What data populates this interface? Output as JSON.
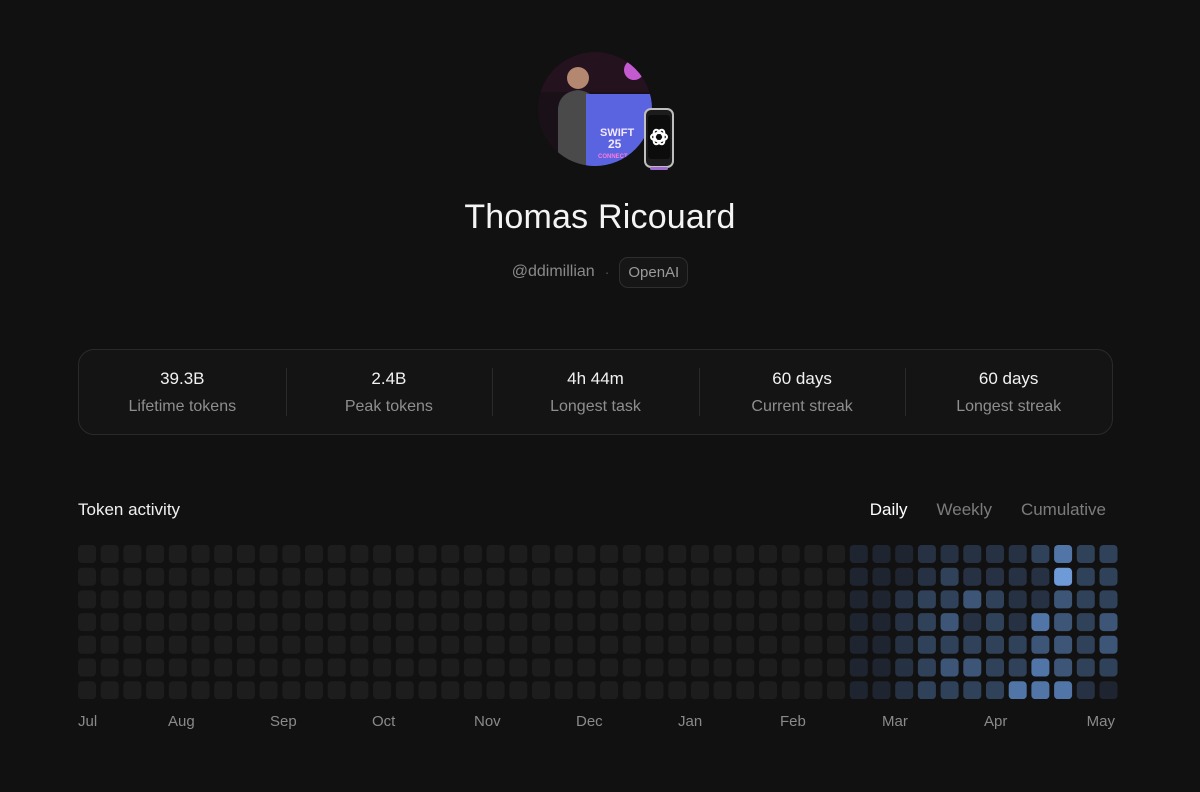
{
  "profile": {
    "name": "Thomas Ricouard",
    "handle": "@ddimillian",
    "separator": "·",
    "provider": "OpenAI",
    "avatar_icon": "profile-photo",
    "badge_icon": "phone-openai-icon"
  },
  "stats": [
    {
      "value": "39.3B",
      "label": "Lifetime tokens"
    },
    {
      "value": "2.4B",
      "label": "Peak tokens"
    },
    {
      "value": "4h 44m",
      "label": "Longest task"
    },
    {
      "value": "60 days",
      "label": "Current streak"
    },
    {
      "value": "60 days",
      "label": "Longest streak"
    }
  ],
  "activity": {
    "title": "Token activity",
    "tabs": [
      {
        "label": "Daily",
        "active": true
      },
      {
        "label": "Weekly",
        "active": false
      },
      {
        "label": "Cumulative",
        "active": false
      }
    ],
    "months": [
      "Jul",
      "Aug",
      "Sep",
      "Oct",
      "Nov",
      "Dec",
      "Jan",
      "Feb",
      "Mar",
      "Apr",
      "May"
    ],
    "weeks": 46,
    "days_per_week": 7,
    "colors": {
      "empty": "#1d1d1d",
      "levels": [
        "#1e2530",
        "#263244",
        "#30415a",
        "#3d5677",
        "#5175a6",
        "#6f9ad8"
      ]
    },
    "active_levels": [
      [
        0,
        0,
        0,
        0,
        0,
        0,
        0
      ],
      [
        0,
        0,
        0,
        0,
        0,
        0,
        0
      ],
      [
        0,
        0,
        1,
        1,
        1,
        1,
        1
      ],
      [
        1,
        1,
        2,
        2,
        2,
        2,
        2
      ],
      [
        1,
        2,
        2,
        3,
        2,
        3,
        2
      ],
      [
        1,
        1,
        3,
        1,
        2,
        3,
        2
      ],
      [
        1,
        1,
        2,
        2,
        2,
        2,
        2
      ],
      [
        1,
        1,
        1,
        1,
        2,
        2,
        4
      ],
      [
        2,
        1,
        1,
        4,
        3,
        4,
        4
      ],
      [
        4,
        5,
        3,
        3,
        3,
        3,
        4
      ],
      [
        2,
        2,
        2,
        2,
        2,
        2,
        1
      ],
      [
        2,
        2,
        2,
        3,
        3,
        2,
        0
      ]
    ]
  }
}
